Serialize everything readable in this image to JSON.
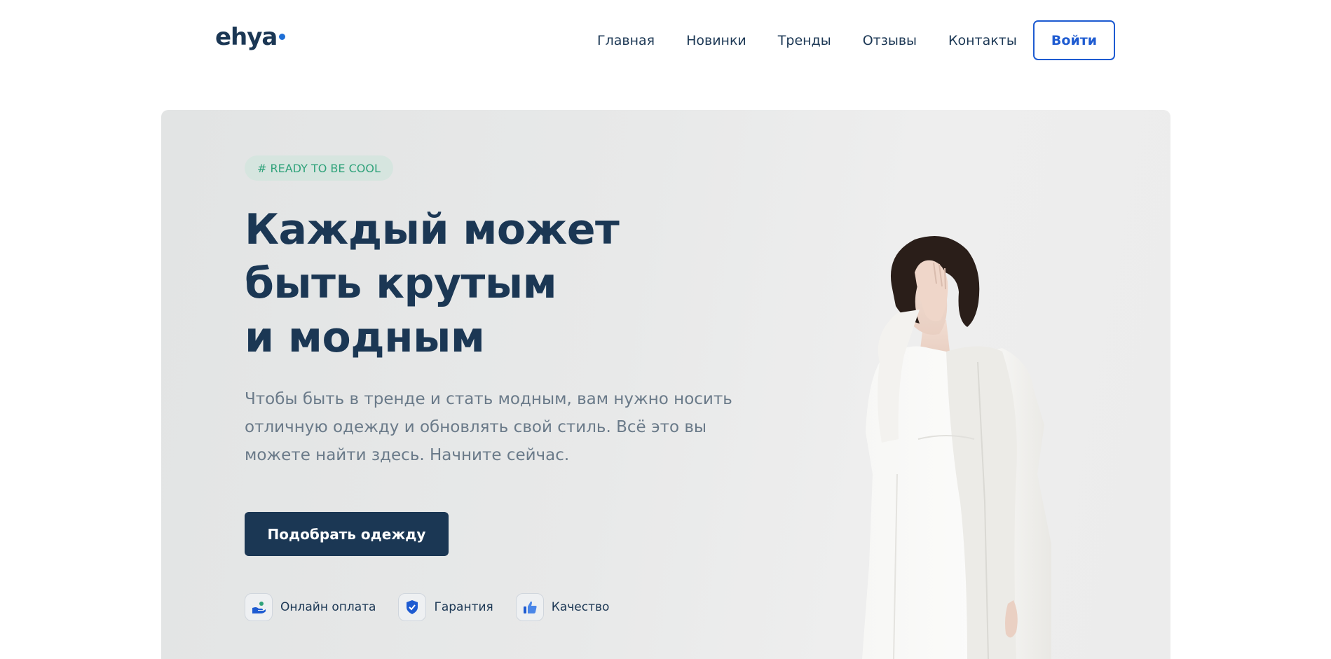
{
  "header": {
    "logo": "ehya",
    "nav": [
      "Главная",
      "Новинки",
      "Тренды",
      "Отзывы",
      "Контакты"
    ],
    "login": "Войти"
  },
  "hero": {
    "tag": "# READY TO BE COOL",
    "headline": [
      "Каждый может",
      "быть крутым",
      "и модным"
    ],
    "description": "Чтобы быть в тренде и стать модным, вам нужно носить отличную одежду и обновлять свой стиль. Всё это вы можете найти здесь. Начните сейчас.",
    "cta": "Подобрать одежду",
    "features": [
      {
        "label": "Онлайн оплата",
        "icon": "hand-coin-icon"
      },
      {
        "label": "Гарантия",
        "icon": "shield-check-icon"
      },
      {
        "label": "Качество",
        "icon": "thumbs-up-icon"
      }
    ]
  },
  "colors": {
    "brand_dark": "#1b3754",
    "accent_blue": "#1e5bd1",
    "tag_green": "#2fa27a"
  }
}
